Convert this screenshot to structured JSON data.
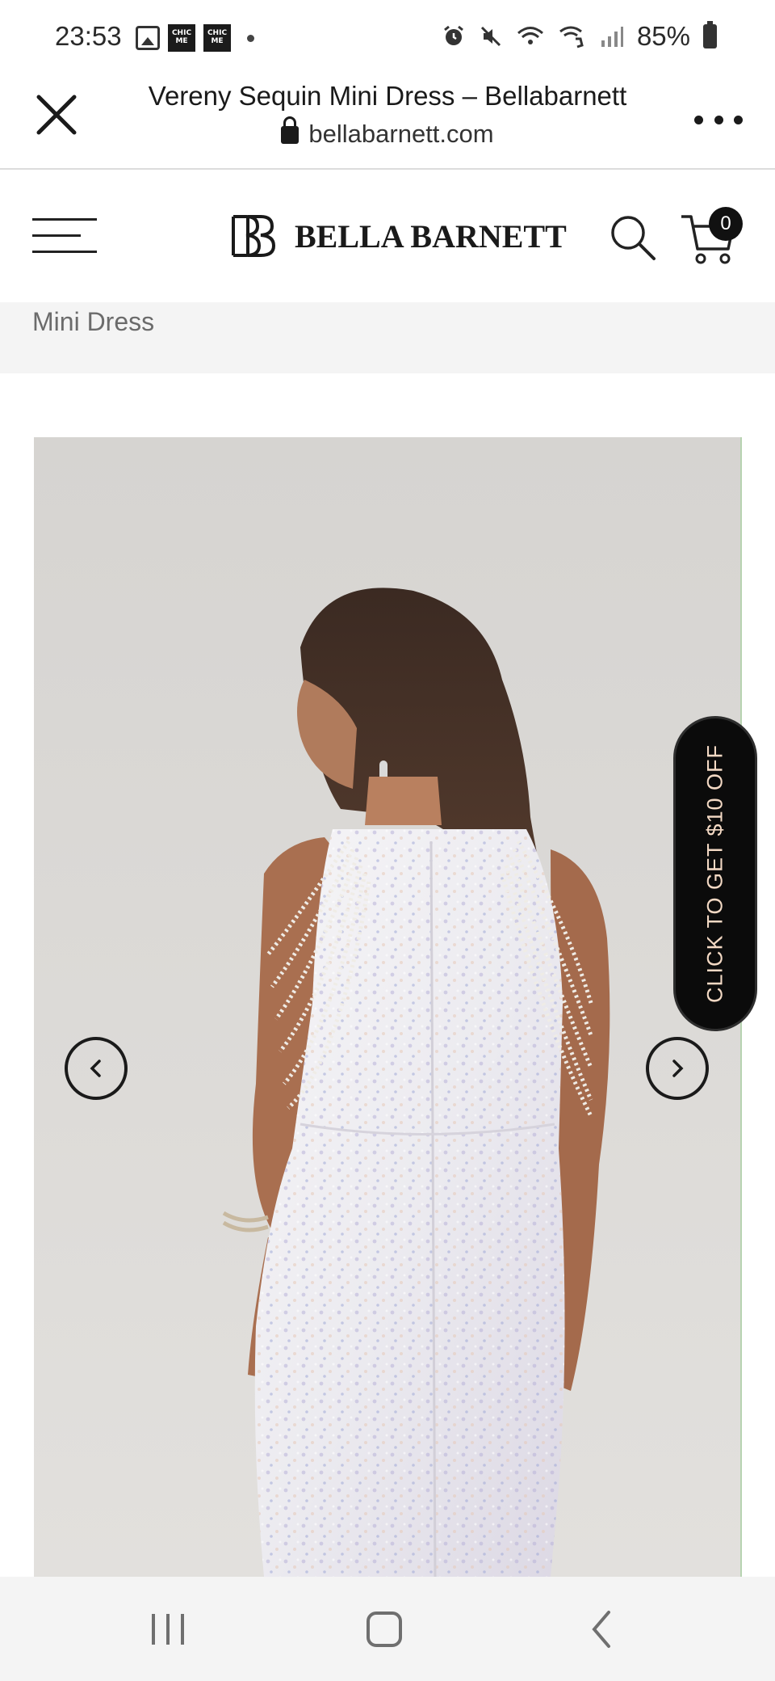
{
  "status_bar": {
    "time": "23:53",
    "notification_icons": [
      "image-icon",
      "chic-me-icon",
      "chic-me-icon",
      "dot-icon"
    ],
    "chic_label": "CHIC ME",
    "system_icons": [
      "alarm-icon",
      "mute-icon",
      "wifi-icon",
      "wifi-call-icon",
      "signal-icon"
    ],
    "battery": "85%"
  },
  "browser": {
    "title": "Vereny Sequin Mini Dress – Bellabarnett",
    "url": "bellabarnett.com"
  },
  "site_header": {
    "logo_text": "BELLA BARNETT",
    "cart_count": "0"
  },
  "breadcrumb": {
    "visible_text": "Mini Dress"
  },
  "promo": {
    "label": "CLICK TO GET $10 OFF"
  },
  "colors": {
    "promo_bg": "#0b0b0b",
    "promo_text": "#f3d9c4",
    "gallery_bg": "#dcdad7",
    "strip_bg": "#f4f4f4"
  }
}
